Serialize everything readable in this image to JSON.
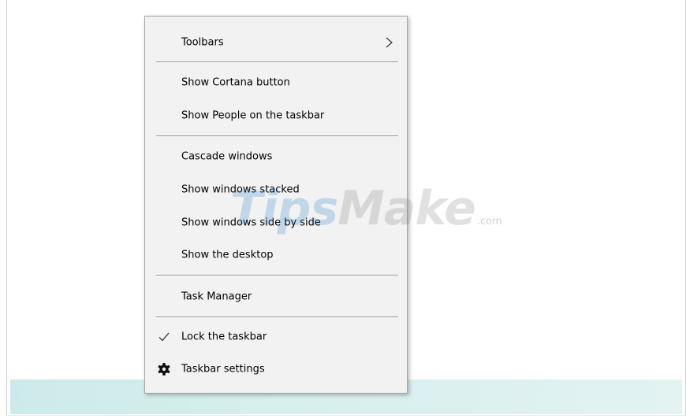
{
  "context_menu": {
    "toolbars": {
      "label": "Toolbars",
      "icon": "chevron-right-icon"
    },
    "show_cortana_button": {
      "label": "Show Cortana button"
    },
    "show_people": {
      "label": "Show People on the taskbar"
    },
    "cascade_windows": {
      "label": "Cascade windows"
    },
    "show_windows_stacked": {
      "label": "Show windows stacked"
    },
    "show_windows_side_by_side": {
      "label": "Show windows side by side"
    },
    "show_desktop": {
      "label": "Show the desktop"
    },
    "task_manager": {
      "label": "Task Manager"
    },
    "lock_taskbar": {
      "label": "Lock the taskbar",
      "checked": true,
      "icon": "checkmark-icon"
    },
    "taskbar_settings": {
      "label": "Taskbar settings",
      "icon": "gear-icon"
    }
  },
  "watermark": {
    "brand_part1": "Tips",
    "brand_part2": "Make",
    "domain": ".com"
  },
  "colors": {
    "menu_background": "#f2f2f2",
    "menu_border": "#a6a6a6",
    "separator": "#a0a0a0",
    "taskbar": "#d6eeee"
  }
}
